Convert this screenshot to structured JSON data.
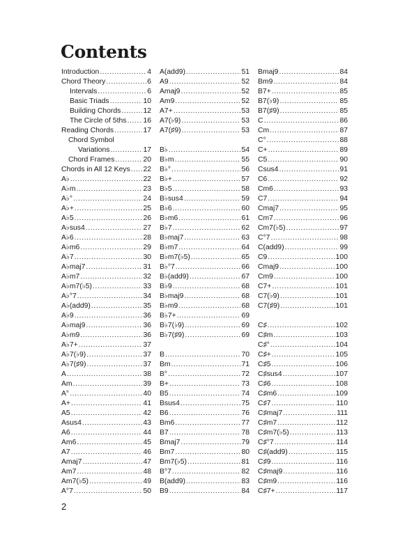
{
  "title": "Contents",
  "page_number": "2",
  "columns": [
    [
      {
        "label": "Introduction",
        "page": "4",
        "indent": 0
      },
      {
        "label": "Chord Theory",
        "page": "6",
        "indent": 0
      },
      {
        "label": "Intervals",
        "page": "6",
        "indent": 1
      },
      {
        "label": "Basic Triads",
        "page": "10",
        "indent": 1
      },
      {
        "label": "Building Chords",
        "page": "12",
        "indent": 1
      },
      {
        "label": "The Circle of 5ths",
        "page": "16",
        "indent": 1
      },
      {
        "label": "Reading Chords",
        "page": "17",
        "indent": 0
      },
      {
        "label": "Chord Symbol",
        "page": "",
        "indent": 2
      },
      {
        "label": "Variations",
        "page": "17",
        "indent": 3
      },
      {
        "label": "Chord Frames",
        "page": "20",
        "indent": 2
      },
      {
        "label": "Chords in All 12 Keys",
        "page": "22",
        "indent": 0
      },
      {
        "label": "A♭",
        "page": "22"
      },
      {
        "label": "A♭m",
        "page": "23"
      },
      {
        "label": "A♭°",
        "page": "24"
      },
      {
        "label": "A♭+",
        "page": "25"
      },
      {
        "label": "A♭5",
        "page": "26"
      },
      {
        "label": "A♭sus4",
        "page": "27"
      },
      {
        "label": "A♭6",
        "page": "28"
      },
      {
        "label": "A♭m6",
        "page": "29"
      },
      {
        "label": "A♭7",
        "page": "30"
      },
      {
        "label": "A♭maj7",
        "page": "31"
      },
      {
        "label": "A♭m7",
        "page": "32"
      },
      {
        "label": "A♭m7(♭5)",
        "page": "33"
      },
      {
        "label": "A♭°7",
        "page": "34"
      },
      {
        "label": "A♭(add9)",
        "page": "35"
      },
      {
        "label": "A♭9",
        "page": "36"
      },
      {
        "label": "A♭maj9",
        "page": "36"
      },
      {
        "label": "A♭m9",
        "page": "36"
      },
      {
        "label": "A♭7+",
        "page": "37"
      },
      {
        "label": "A♭7(♭9)",
        "page": "37"
      },
      {
        "label": "A♭7(♯9)",
        "page": "37"
      },
      {
        "label": "A",
        "page": "38"
      },
      {
        "label": "Am",
        "page": "39"
      },
      {
        "label": "A°",
        "page": "40"
      },
      {
        "label": "A+",
        "page": "41"
      },
      {
        "label": "A5",
        "page": "42"
      },
      {
        "label": "Asus4",
        "page": "43"
      },
      {
        "label": "A6",
        "page": "44"
      },
      {
        "label": "Am6",
        "page": "45"
      },
      {
        "label": "A7",
        "page": "46"
      },
      {
        "label": "Amaj7",
        "page": "47"
      },
      {
        "label": "Am7",
        "page": "48"
      },
      {
        "label": "Am7(♭5)",
        "page": "49"
      },
      {
        "label": "A°7",
        "page": "50"
      }
    ],
    [
      {
        "label": "A(add9)",
        "page": "51"
      },
      {
        "label": "A9",
        "page": "52"
      },
      {
        "label": "Amaj9",
        "page": "52"
      },
      {
        "label": "Am9",
        "page": "52"
      },
      {
        "label": "A7+",
        "page": "53"
      },
      {
        "label": "A7(♭9)",
        "page": "53"
      },
      {
        "label": "A7(♯9)",
        "page": "53"
      },
      {
        "blank": true
      },
      {
        "label": "B♭",
        "page": "54"
      },
      {
        "label": "B♭m",
        "page": "55"
      },
      {
        "label": "B♭°",
        "page": "56"
      },
      {
        "label": "B♭+",
        "page": "57"
      },
      {
        "label": "B♭5",
        "page": "58"
      },
      {
        "label": "B♭sus4",
        "page": "59"
      },
      {
        "label": "B♭6",
        "page": "60"
      },
      {
        "label": "B♭m6",
        "page": "61"
      },
      {
        "label": "B♭7",
        "page": "62"
      },
      {
        "label": "B♭maj7",
        "page": "63"
      },
      {
        "label": "B♭m7",
        "page": "64"
      },
      {
        "label": "B♭m7(♭5)",
        "page": "65"
      },
      {
        "label": "B♭°7",
        "page": "66"
      },
      {
        "label": "B♭(add9)",
        "page": "67"
      },
      {
        "label": "B♭9",
        "page": "68"
      },
      {
        "label": "B♭maj9",
        "page": "68"
      },
      {
        "label": "B♭m9",
        "page": "68"
      },
      {
        "label": "B♭7+",
        "page": "69"
      },
      {
        "label": "B♭7(♭9)",
        "page": "69"
      },
      {
        "label": "B♭7(♯9)",
        "page": "69"
      },
      {
        "blank": true
      },
      {
        "label": "B",
        "page": "70"
      },
      {
        "label": "Bm",
        "page": "71"
      },
      {
        "label": "B°",
        "page": "72"
      },
      {
        "label": "B+",
        "page": "73"
      },
      {
        "label": "B5",
        "page": "74"
      },
      {
        "label": "Bsus4",
        "page": "75"
      },
      {
        "label": "B6",
        "page": "76"
      },
      {
        "label": "Bm6",
        "page": "77"
      },
      {
        "label": "B7",
        "page": "78"
      },
      {
        "label": "Bmaj7",
        "page": "79"
      },
      {
        "label": "Bm7",
        "page": "80"
      },
      {
        "label": "Bm7(♭5)",
        "page": "81"
      },
      {
        "label": "B°7",
        "page": "82"
      },
      {
        "label": "B(add9)",
        "page": "83"
      },
      {
        "label": "B9",
        "page": "84"
      }
    ],
    [
      {
        "label": "Bmaj9",
        "page": "84"
      },
      {
        "label": "Bm9",
        "page": "84"
      },
      {
        "label": "B7+",
        "page": "85"
      },
      {
        "label": "B7(♭9)",
        "page": "85"
      },
      {
        "label": "B7(♯9)",
        "page": "85"
      },
      {
        "label": "C",
        "page": "86"
      },
      {
        "label": "Cm",
        "page": "87"
      },
      {
        "label": "C°",
        "page": "88"
      },
      {
        "label": "C+",
        "page": "89"
      },
      {
        "label": "C5",
        "page": "90"
      },
      {
        "label": "Csus4",
        "page": "91"
      },
      {
        "label": "C6",
        "page": "92"
      },
      {
        "label": "Cm6",
        "page": "93"
      },
      {
        "label": "C7",
        "page": "94"
      },
      {
        "label": "Cmaj7",
        "page": "95"
      },
      {
        "label": "Cm7",
        "page": "96"
      },
      {
        "label": "Cm7(♭5)",
        "page": "97"
      },
      {
        "label": "C°7",
        "page": "98"
      },
      {
        "label": "C(add9)",
        "page": "99"
      },
      {
        "label": "C9",
        "page": "100"
      },
      {
        "label": "Cmaj9",
        "page": "100"
      },
      {
        "label": "Cm9",
        "page": "100"
      },
      {
        "label": "C7+",
        "page": "101"
      },
      {
        "label": "C7(♭9)",
        "page": "101"
      },
      {
        "label": "C7(♯9)",
        "page": "101"
      },
      {
        "blank": true
      },
      {
        "label": "C♯",
        "page": "102"
      },
      {
        "label": "C♯m",
        "page": "103"
      },
      {
        "label": "C♯°",
        "page": "104"
      },
      {
        "label": "C♯+",
        "page": "105"
      },
      {
        "label": "C♯5",
        "page": "106"
      },
      {
        "label": "C♯sus4",
        "page": "107"
      },
      {
        "label": "C♯6",
        "page": "108"
      },
      {
        "label": "C♯m6",
        "page": "109"
      },
      {
        "label": "C♯7",
        "page": "110"
      },
      {
        "label": "C♯maj7",
        "page": "111"
      },
      {
        "label": "C♯m7",
        "page": "112"
      },
      {
        "label": "C♯m7(♭5)",
        "page": "113"
      },
      {
        "label": "C♯°7",
        "page": "114"
      },
      {
        "label": "C♯(add9)",
        "page": "115"
      },
      {
        "label": "C♯9",
        "page": "116"
      },
      {
        "label": "C♯maj9",
        "page": "116"
      },
      {
        "label": "C♯m9",
        "page": "116"
      },
      {
        "label": "C♯7+",
        "page": "117"
      }
    ]
  ]
}
